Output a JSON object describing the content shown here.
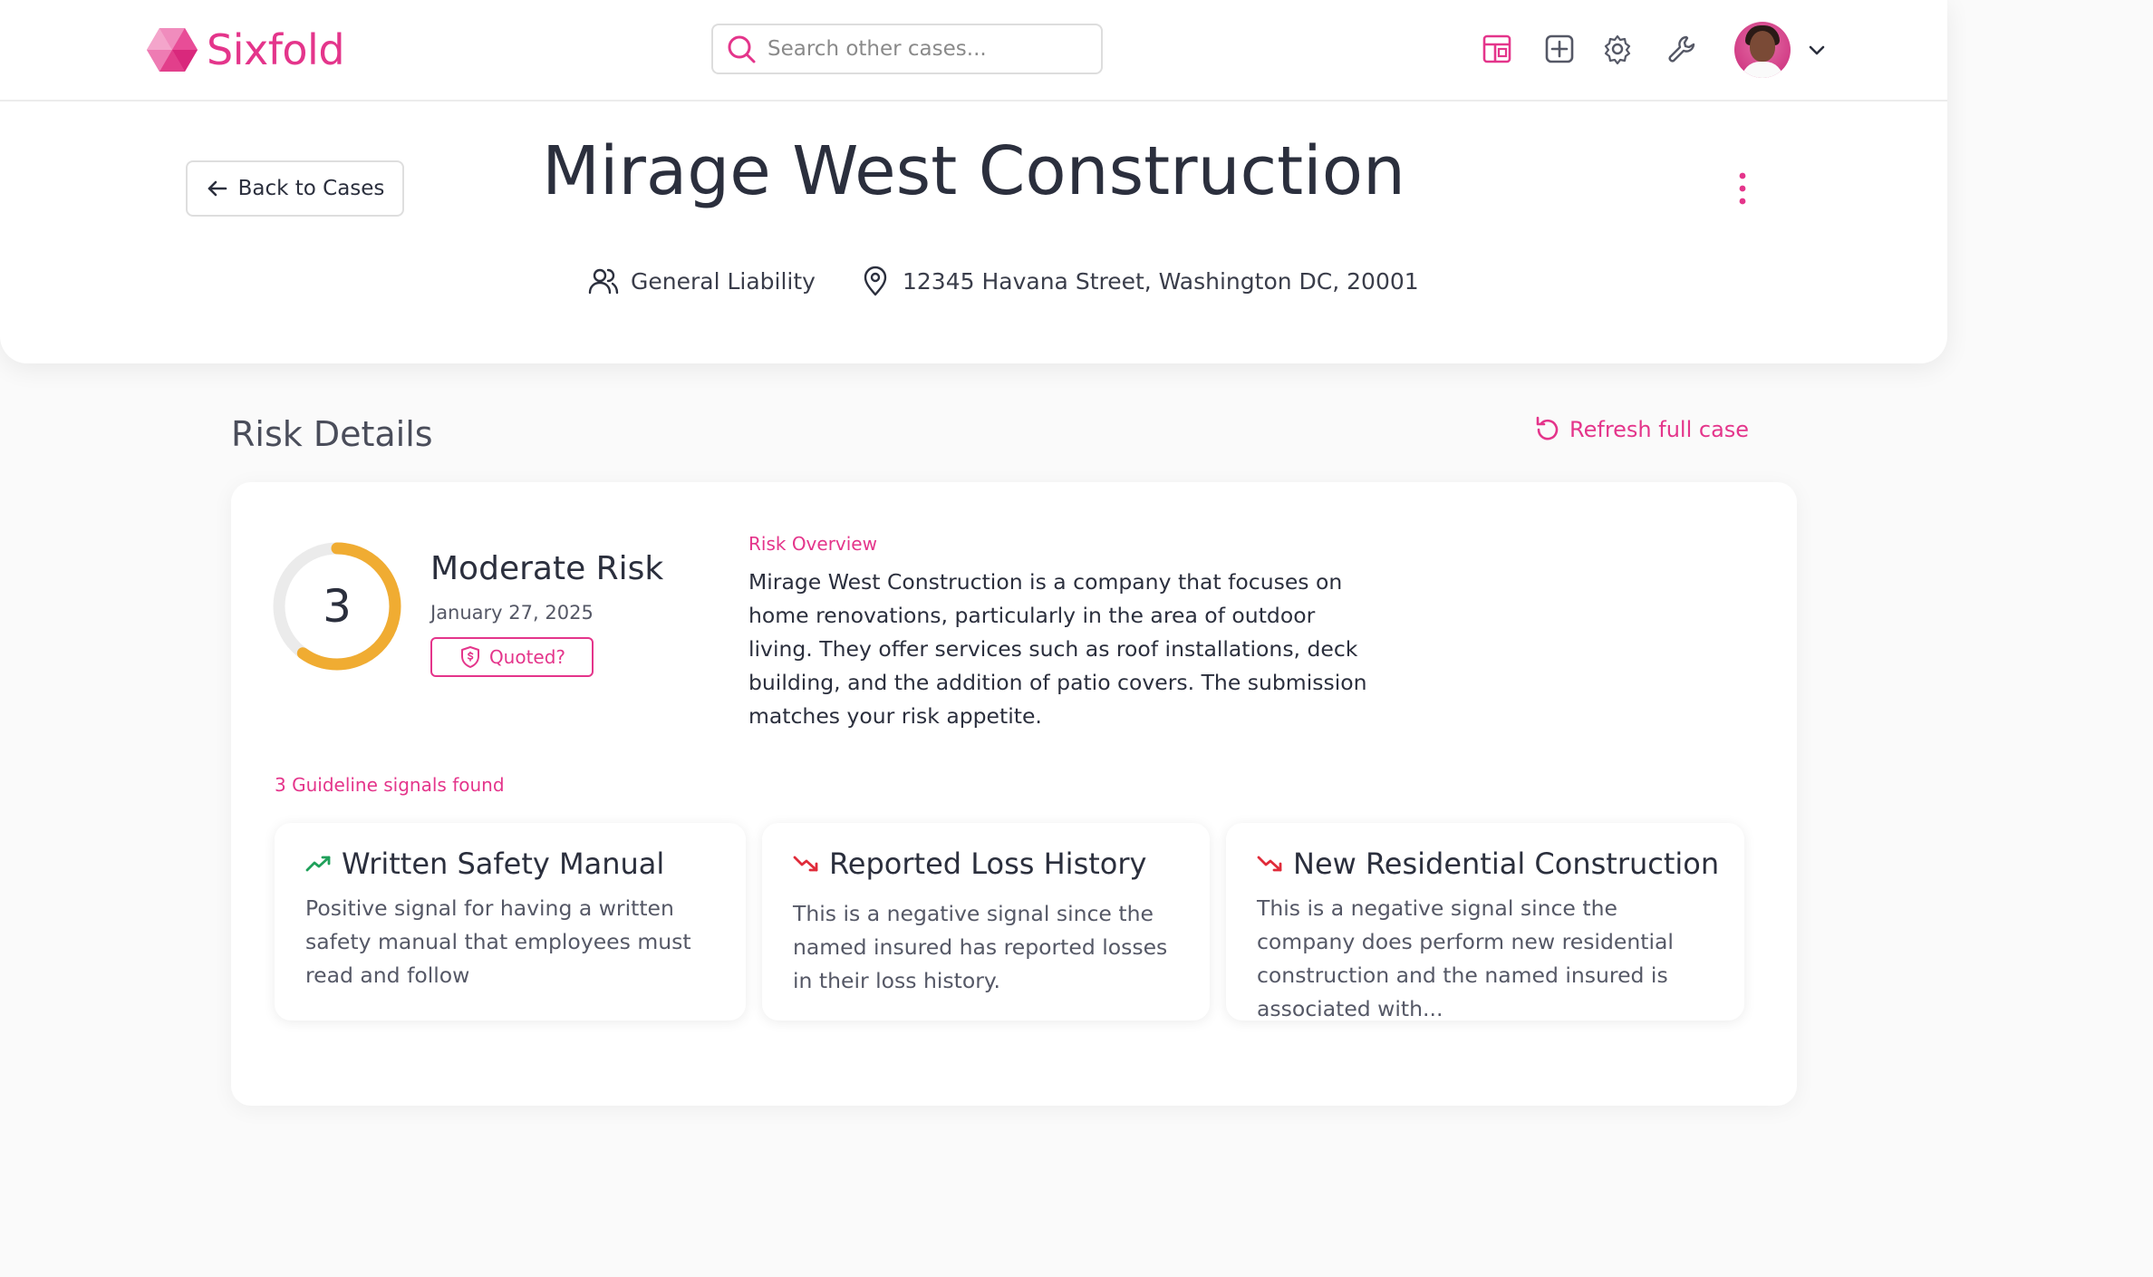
{
  "app": {
    "name": "Sixfold"
  },
  "nav": {
    "search_placeholder": "Search other cases...",
    "icons": [
      "dashboard-icon",
      "add-case-icon",
      "settings-icon",
      "tools-icon"
    ],
    "accent_color": "#e4358b"
  },
  "header": {
    "back_label": "Back to Cases",
    "title": "Mirage West Construction",
    "line_of_business": "General Liability",
    "address": "12345 Havana Street, Washington DC, 20001"
  },
  "risk": {
    "section_title": "Risk Details",
    "refresh_label": "Refresh full case",
    "score": "3",
    "score_fraction": 0.6,
    "score_color": "#f0ac32",
    "level": "Moderate Risk",
    "date": "January 27, 2025",
    "quoted_label": "Quoted?",
    "overview_label": "Risk Overview",
    "overview_text": "Mirage West Construction is a company that focuses on home renovations, particularly in the area of outdoor living. They offer services such as roof installations, deck building, and the addition of patio covers. The submission matches your risk appetite.",
    "signals_label": "3 Guideline signals found",
    "signals": [
      {
        "title": "Written Safety Manual",
        "trend": "positive",
        "description": "Positive signal for having a written safety manual that employees must read and follow"
      },
      {
        "title": "Reported Loss History",
        "trend": "negative",
        "description": "This is a negative signal since the named insured has reported losses in their loss history."
      },
      {
        "title": "New Residential Construction",
        "trend": "negative",
        "description": "This is a negative signal since the company does perform new residential construction and the named insured is associated with..."
      }
    ],
    "positive_color": "#1fa05a",
    "negative_color": "#e02b3a"
  }
}
